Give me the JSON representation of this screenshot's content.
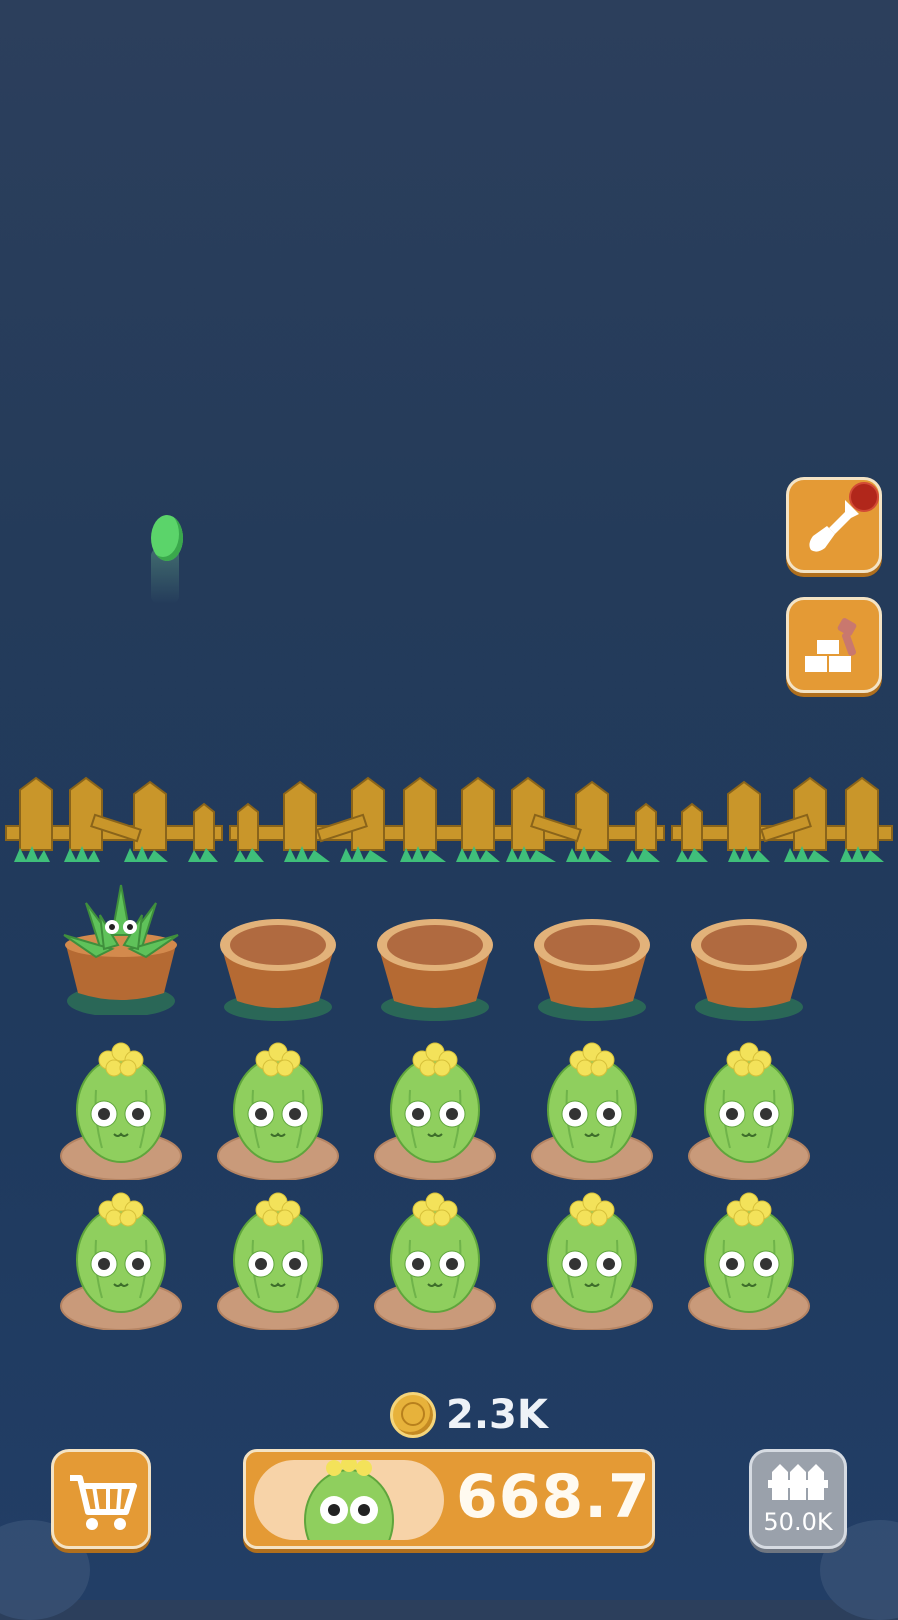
{
  "tools": {
    "shovel_icon": "shovel-icon",
    "build_icon": "build-icon",
    "has_notification": true
  },
  "grid": {
    "rows": [
      [
        "aloe",
        "pot",
        "pot",
        "pot",
        "pot"
      ],
      [
        "cactus",
        "cactus",
        "cactus",
        "cactus",
        "cactus"
      ],
      [
        "cactus",
        "cactus",
        "cactus",
        "cactus",
        "cactus"
      ]
    ]
  },
  "currency": {
    "coins": "2.3K"
  },
  "bottom_bar": {
    "buy_price": "668.7",
    "fence_cost": "50.0K"
  },
  "colors": {
    "accent": "#e49a35",
    "background": "#243b5a",
    "plant_green": "#8fcf5e"
  }
}
